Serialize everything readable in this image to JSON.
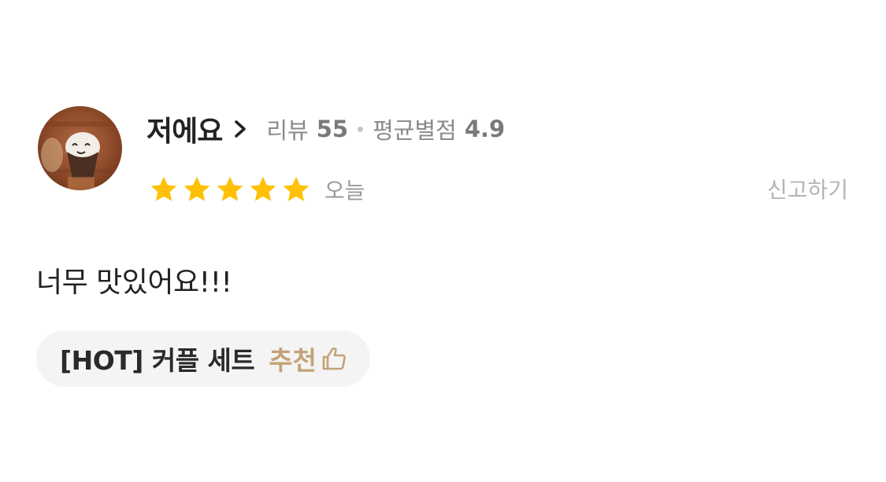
{
  "review": {
    "user": {
      "name": "저에요",
      "review_label": "리뷰",
      "review_count": "55",
      "avg_label": "평균별점",
      "avg_rating": "4.9"
    },
    "rating": 5,
    "max_rating": 5,
    "date": "오늘",
    "report_label": "신고하기",
    "text": "너무 맛있어요!!!",
    "menu": {
      "name": "[HOT]  커플 세트",
      "recommend_label": "추천"
    }
  },
  "colors": {
    "star": "#FFC107",
    "recommend": "#C4A277",
    "chip_bg": "#F4F4F4"
  },
  "icons": {
    "chevron": "chevron-right-icon",
    "star": "star-icon",
    "thumb": "thumbs-up-icon"
  }
}
